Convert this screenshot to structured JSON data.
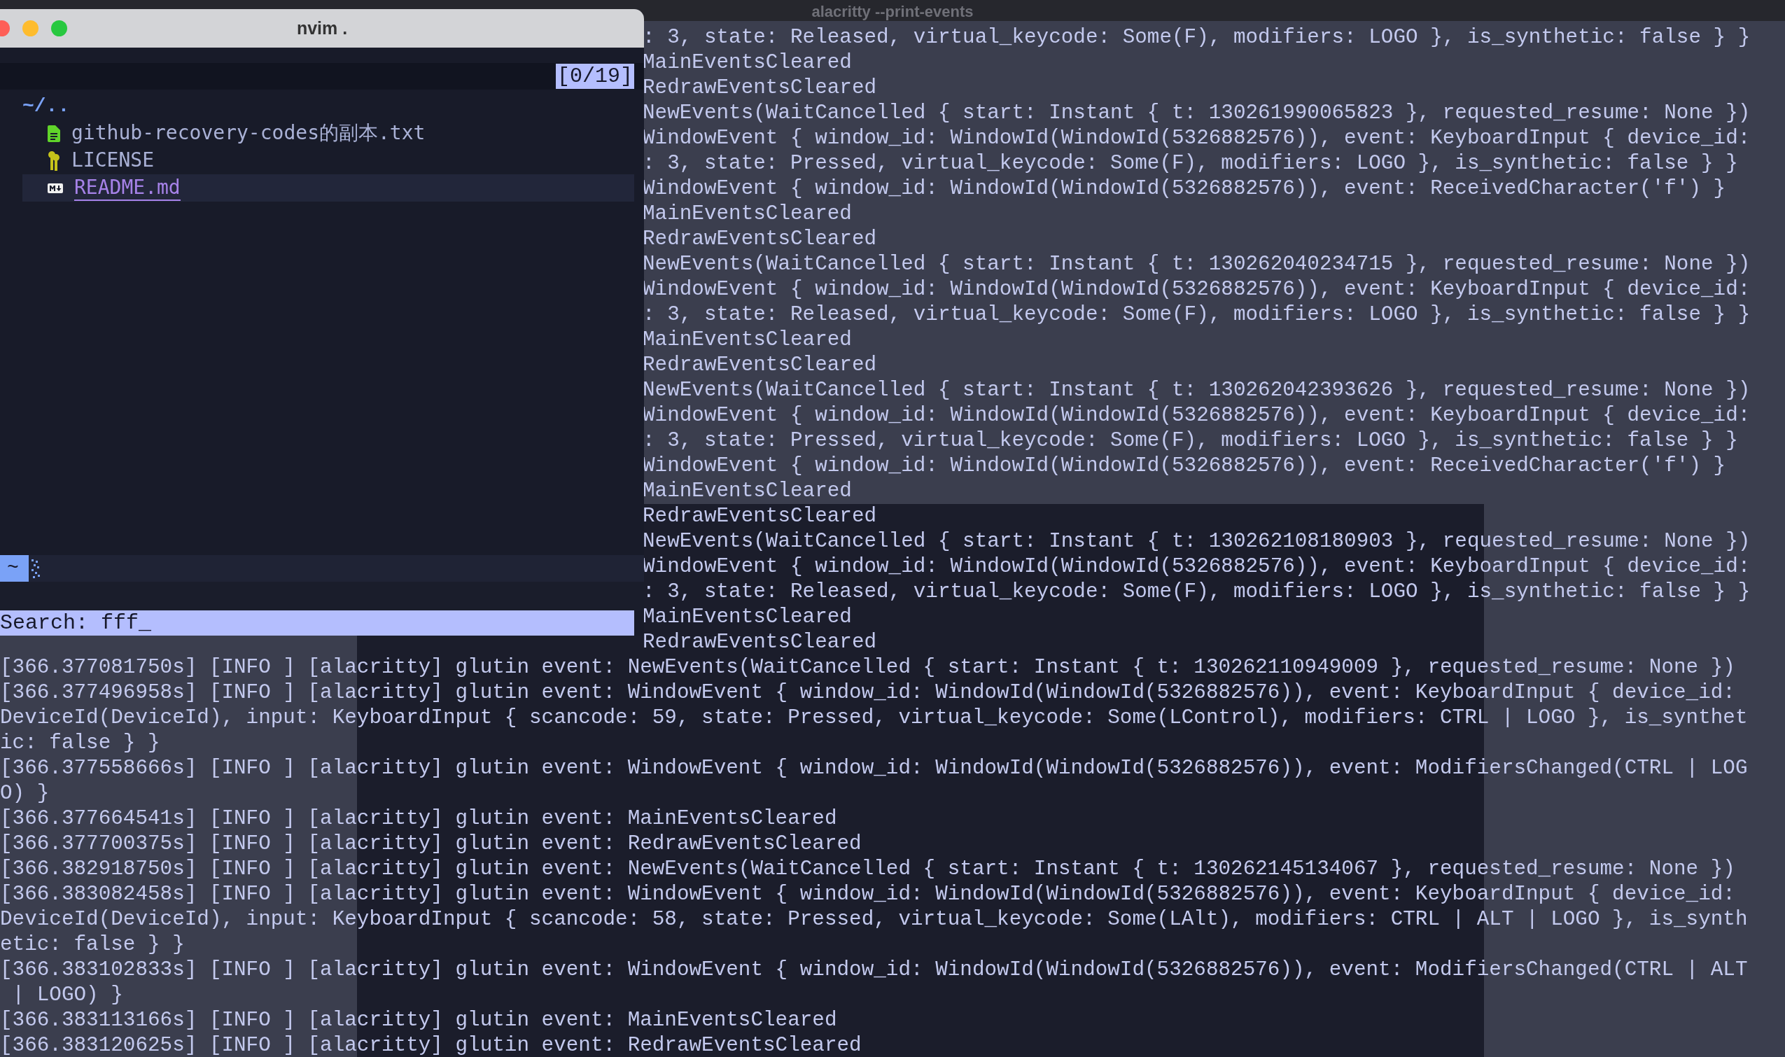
{
  "terminal": {
    "title": "alacritty --print-events",
    "top_lines": [
      ": 3, state: Released, virtual_keycode: Some(F), modifiers: LOGO }, is_synthetic: false } }",
      "MainEventsCleared",
      "RedrawEventsCleared",
      "NewEvents(WaitCancelled { start: Instant { t: 130261990065823 }, requested_resume: None })",
      "WindowEvent { window_id: WindowId(WindowId(5326882576)), event: KeyboardInput { device_id:",
      ": 3, state: Pressed, virtual_keycode: Some(F), modifiers: LOGO }, is_synthetic: false } }",
      "WindowEvent { window_id: WindowId(WindowId(5326882576)), event: ReceivedCharacter('f') }",
      "MainEventsCleared",
      "RedrawEventsCleared",
      "NewEvents(WaitCancelled { start: Instant { t: 130262040234715 }, requested_resume: None })",
      "WindowEvent { window_id: WindowId(WindowId(5326882576)), event: KeyboardInput { device_id:",
      ": 3, state: Released, virtual_keycode: Some(F), modifiers: LOGO }, is_synthetic: false } }",
      "MainEventsCleared",
      "RedrawEventsCleared",
      "NewEvents(WaitCancelled { start: Instant { t: 130262042393626 }, requested_resume: None })",
      "WindowEvent { window_id: WindowId(WindowId(5326882576)), event: KeyboardInput { device_id:",
      ": 3, state: Pressed, virtual_keycode: Some(F), modifiers: LOGO }, is_synthetic: false } }",
      "WindowEvent { window_id: WindowId(WindowId(5326882576)), event: ReceivedCharacter('f') }",
      "MainEventsCleared",
      "RedrawEventsCleared",
      "NewEvents(WaitCancelled { start: Instant { t: 130262108180903 }, requested_resume: None })",
      "WindowEvent { window_id: WindowId(WindowId(5326882576)), event: KeyboardInput { device_id:",
      ": 3, state: Released, virtual_keycode: Some(F), modifiers: LOGO }, is_synthetic: false } }",
      "MainEventsCleared",
      "RedrawEventsCleared"
    ],
    "log_lines": [
      "[366.377081750s] [INFO ] [alacritty] glutin event: NewEvents(WaitCancelled { start: Instant { t: 130262110949009 }, requested_resume: None })",
      "[366.377496958s] [INFO ] [alacritty] glutin event: WindowEvent { window_id: WindowId(WindowId(5326882576)), event: KeyboardInput { device_id:",
      "DeviceId(DeviceId), input: KeyboardInput { scancode: 59, state: Pressed, virtual_keycode: Some(LControl), modifiers: CTRL | LOGO }, is_synthet",
      "ic: false } }",
      "[366.377558666s] [INFO ] [alacritty] glutin event: WindowEvent { window_id: WindowId(WindowId(5326882576)), event: ModifiersChanged(CTRL | LOG",
      "O) }",
      "[366.377664541s] [INFO ] [alacritty] glutin event: MainEventsCleared",
      "[366.377700375s] [INFO ] [alacritty] glutin event: RedrawEventsCleared",
      "[366.382918750s] [INFO ] [alacritty] glutin event: NewEvents(WaitCancelled { start: Instant { t: 130262145134067 }, requested_resume: None })",
      "[366.383082458s] [INFO ] [alacritty] glutin event: WindowEvent { window_id: WindowId(WindowId(5326882576)), event: KeyboardInput { device_id:",
      "DeviceId(DeviceId), input: KeyboardInput { scancode: 58, state: Pressed, virtual_keycode: Some(LAlt), modifiers: CTRL | ALT | LOGO }, is_synth",
      "etic: false } }",
      "[366.383102833s] [INFO ] [alacritty] glutin event: WindowEvent { window_id: WindowId(WindowId(5326882576)), event: ModifiersChanged(CTRL | ALT",
      " | LOGO) }",
      "[366.383113166s] [INFO ] [alacritty] glutin event: MainEventsCleared",
      "[366.383120625s] [INFO ] [alacritty] glutin event: RedrawEventsCleared"
    ]
  },
  "nvim": {
    "title": "nvim .",
    "match_count": "[0/19]",
    "root": "~/..",
    "items": [
      {
        "name": "github-recovery-codes的副本.txt",
        "kind": "text",
        "selected": false
      },
      {
        "name": "LICENSE",
        "kind": "license",
        "selected": false
      },
      {
        "name": "README.md",
        "kind": "markdown",
        "selected": true
      }
    ],
    "mode": "~",
    "search": "Search: fff_"
  }
}
